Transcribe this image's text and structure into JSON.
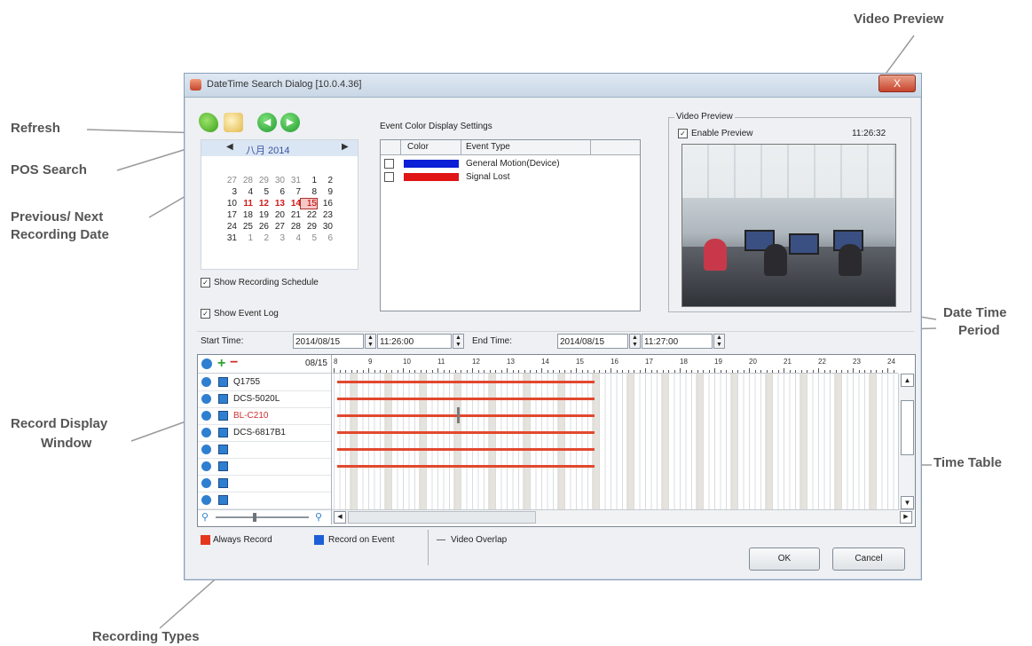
{
  "callouts": {
    "refresh": "Refresh",
    "pos_search": "POS Search",
    "prev_next_1": "Previous/ Next",
    "prev_next_2": "Recording Date",
    "record_display_1": "Record Display",
    "record_display_2": "Window",
    "recording_types": "Recording Types",
    "video_preview": "Video Preview",
    "date_time_1": "Date Time",
    "date_time_2": "Period",
    "time_table": "Time Table"
  },
  "dialog": {
    "title": "DateTime Search Dialog [10.0.4.36]",
    "close": "X",
    "calendar": {
      "month_label": "八月 2014",
      "prev": "◀",
      "next": "▶",
      "weeks": [
        [
          "27",
          "28",
          "29",
          "30",
          "31",
          "1",
          "2"
        ],
        [
          "3",
          "4",
          "5",
          "6",
          "7",
          "8",
          "9"
        ],
        [
          "10",
          "11",
          "12",
          "13",
          "14",
          "15",
          "16"
        ],
        [
          "17",
          "18",
          "19",
          "20",
          "21",
          "22",
          "23"
        ],
        [
          "24",
          "25",
          "26",
          "27",
          "28",
          "29",
          "30"
        ],
        [
          "31",
          "1",
          "2",
          "3",
          "4",
          "5",
          "6"
        ]
      ]
    },
    "show_recording_schedule": "Show Recording Schedule",
    "show_event_log": "Show Event Log",
    "event_settings": {
      "title": "Event Color Display Settings",
      "col_color": "Color",
      "col_event": "Event Type",
      "rows": [
        {
          "label": "General Motion(Device)",
          "color": "#0a1fd6"
        },
        {
          "label": "Signal Lost",
          "color": "#e01515"
        }
      ]
    },
    "preview": {
      "group_label": "Video Preview",
      "enable_label": "Enable Preview",
      "time": "11:26:32"
    },
    "time": {
      "start_label": "Start Time:",
      "start_date": "2014/08/15",
      "start_time": "11:26:00",
      "end_label": "End Time:",
      "end_date": "2014/08/15",
      "end_time": "11:27:00"
    },
    "records": {
      "date": "08/15",
      "hours": [
        "8",
        "9",
        "10",
        "11",
        "12",
        "13",
        "14",
        "15",
        "16",
        "17",
        "18",
        "19",
        "20",
        "21",
        "22",
        "23",
        "24"
      ],
      "cameras": [
        "Q1755",
        "DCS-5020L",
        "BL-C210",
        "DCS-6817B1",
        "",
        "",
        "",
        ""
      ]
    },
    "legend": {
      "always": "Always Record",
      "event": "Record on Event",
      "overlap": "Video Overlap",
      "always_color": "#e5361c",
      "event_color": "#1d5fd6"
    },
    "ok": "OK",
    "cancel": "Cancel"
  }
}
